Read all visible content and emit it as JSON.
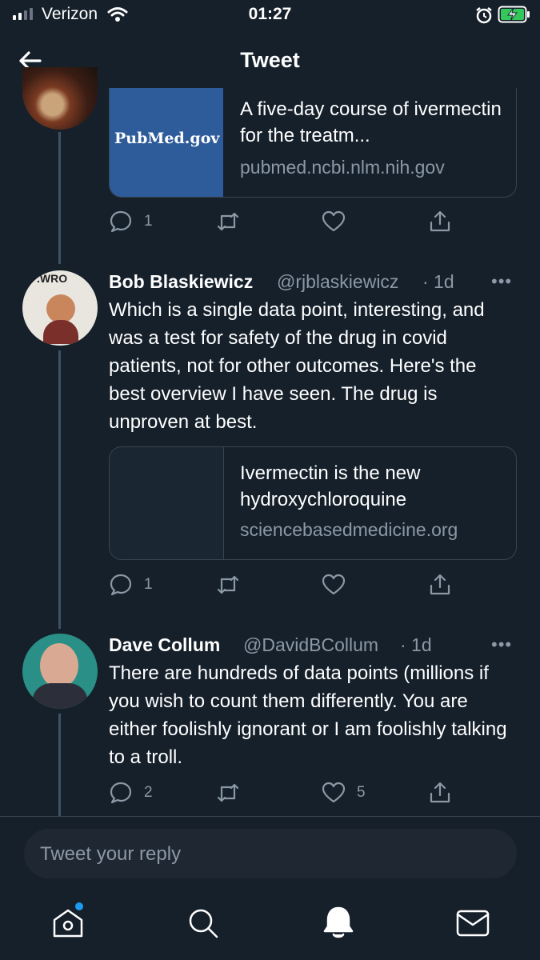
{
  "status_bar": {
    "carrier": "Verizon",
    "time": "01:27"
  },
  "header": {
    "title": "Tweet"
  },
  "tweets": [
    {
      "card": {
        "image_text": "PubMed.gov",
        "title": "A five-day course of ivermectin for the treatm...",
        "domain": "pubmed.ncbi.nlm.nih.gov"
      },
      "actions": {
        "replies": "1",
        "retweets": "",
        "likes": ""
      }
    },
    {
      "name": "Bob Blaskiewicz",
      "handle": "@rjblaskiewicz",
      "time": "· 1d",
      "text": "Which is a single data point, interesting, and was a test for safety of the drug in covid patients, not for other outcomes. Here's the best overview I have seen. The drug is unproven at best.",
      "avatar_text": ".WRO",
      "card": {
        "title": "Ivermectin is the new hydroxychloroquine",
        "domain": "sciencebasedmedicine.org"
      },
      "actions": {
        "replies": "1",
        "retweets": "",
        "likes": ""
      }
    },
    {
      "name": "Dave Collum",
      "handle": "@DavidBCollum",
      "time": "· 1d",
      "text": "There are hundreds of data points (millions if you wish to count them differently. You are either foolishly ignorant or I am foolishly talking to a troll.",
      "actions": {
        "replies": "2",
        "retweets": "",
        "likes": "5"
      }
    }
  ],
  "reply_box": {
    "placeholder": "Tweet your reply"
  },
  "tab_bar": {
    "items": [
      "home-icon",
      "search-icon",
      "notifications-icon",
      "messages-icon"
    ]
  },
  "colors": {
    "background": "#15202b",
    "secondary_text": "#8b98a5",
    "accent": "#1d9bf0",
    "divider": "#38444d"
  }
}
